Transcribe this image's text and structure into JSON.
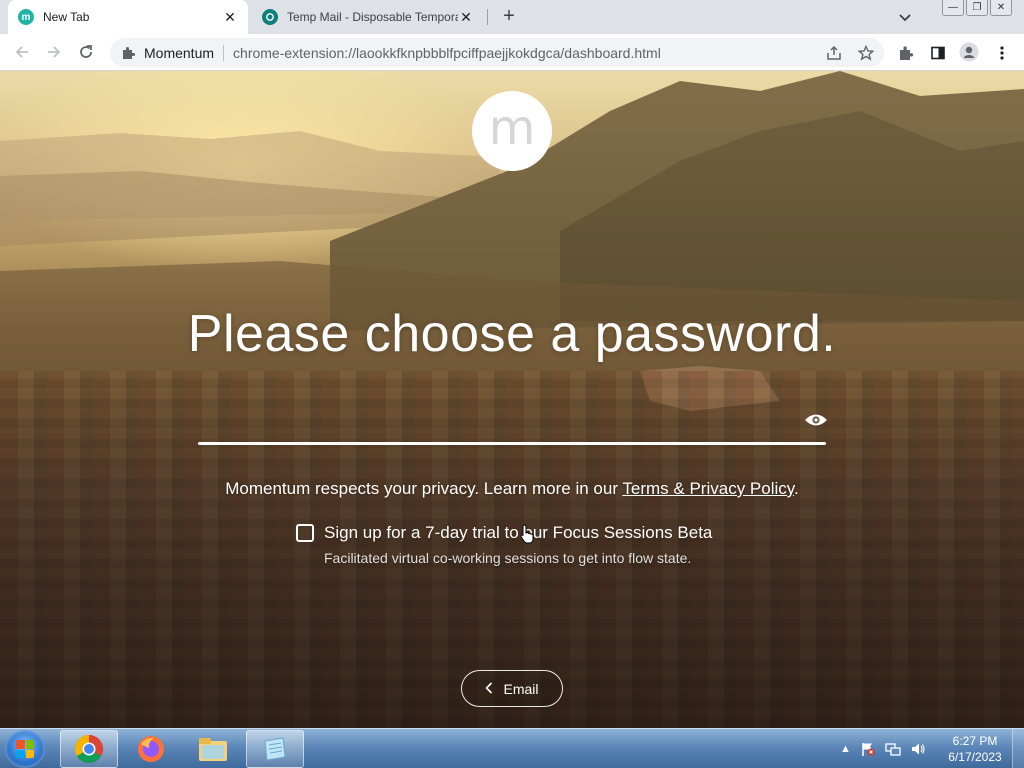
{
  "tabs": [
    {
      "title": "New Tab",
      "favicon_letter": "m",
      "active": true
    },
    {
      "title": "Temp Mail - Disposable Tempora",
      "favicon_letter": "",
      "active": false
    }
  ],
  "window_controls": {
    "minimize": "—",
    "restore": "❐",
    "close": "✕"
  },
  "toolbar": {
    "site_name": "Momentum",
    "url": "chrome-extension://laookkfknpbbblfpciffpaejjkokdgca/dashboard.html"
  },
  "momentum": {
    "logo_letter": "m",
    "headline": "Please choose a password.",
    "password_value": "",
    "privacy_prefix": "Momentum respects your privacy. Learn more in our ",
    "privacy_link": "Terms & Privacy Policy",
    "privacy_suffix": ".",
    "signup_label": "Sign up for a 7-day trial to our Focus Sessions Beta",
    "signup_checked": false,
    "signup_note": "Facilitated virtual co-working sessions to get into flow state.",
    "back_label": "Email"
  },
  "taskbar": {
    "time": "6:27 PM",
    "date": "6/17/2023"
  },
  "colors": {
    "momentum_teal": "#1fb5a6",
    "tempmail_teal": "#0f7f7a",
    "taskbar_blue": "#3f6a9c"
  }
}
